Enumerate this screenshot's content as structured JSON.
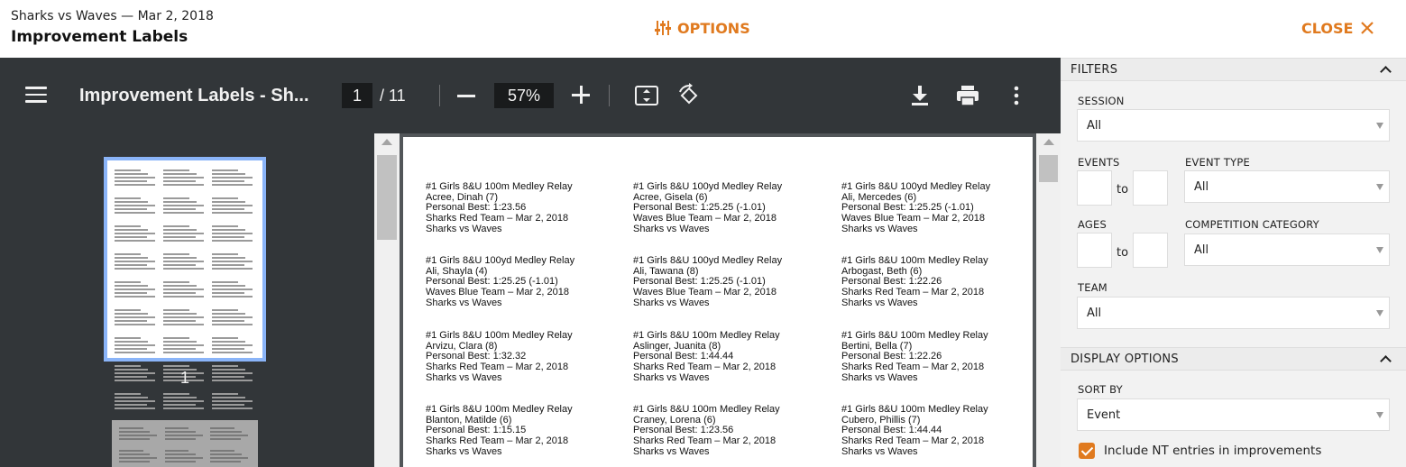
{
  "header": {
    "meet_title": "Sharks vs Waves — Mar 2, 2018",
    "page_title": "Improvement Labels",
    "options_label": "OPTIONS",
    "close_label": "CLOSE",
    "accent_color": "#e07a1f"
  },
  "viewer": {
    "doc_name": "Improvement Labels - Sh...",
    "current_page": "1",
    "total_pages": "/ 11",
    "zoom": "57%",
    "thumbnail_page": "1",
    "icons": [
      "menu-icon",
      "zoom-out-icon",
      "zoom-in-icon",
      "fit-page-icon",
      "rotate-icon",
      "download-icon",
      "print-icon",
      "more-vert-icon"
    ]
  },
  "labels": [
    [
      "#1 Girls 8&U 100m Medley Relay",
      "Acree, Dinah (7)",
      "Personal Best: 1:23.56",
      "Sharks Red Team – Mar 2, 2018",
      "Sharks vs Waves"
    ],
    [
      "#1 Girls 8&U 100yd Medley Relay",
      "Acree, Gisela (6)",
      "Personal Best: 1:25.25   (-1.01)",
      "Waves Blue Team – Mar 2, 2018",
      "Sharks vs Waves"
    ],
    [
      "#1 Girls 8&U 100yd Medley Relay",
      "Ali, Mercedes (6)",
      "Personal Best: 1:25.25   (-1.01)",
      "Waves Blue Team – Mar 2, 2018",
      "Sharks vs Waves"
    ],
    [
      "#1 Girls 8&U 100yd Medley Relay",
      "Ali, Shayla (4)",
      "Personal Best: 1:25.25   (-1.01)",
      "Waves Blue Team – Mar 2, 2018",
      "Sharks vs Waves"
    ],
    [
      "#1 Girls 8&U 100yd Medley Relay",
      "Ali, Tawana (8)",
      "Personal Best: 1:25.25   (-1.01)",
      "Waves Blue Team – Mar 2, 2018",
      "Sharks vs Waves"
    ],
    [
      "#1 Girls 8&U 100m Medley Relay",
      "Arbogast, Beth (6)",
      "Personal Best: 1:22.26",
      "Sharks Red Team – Mar 2, 2018",
      "Sharks vs Waves"
    ],
    [
      "#1 Girls 8&U 100m Medley Relay",
      "Arvizu, Clara (8)",
      "Personal Best: 1:32.32",
      "Sharks Red Team – Mar 2, 2018",
      "Sharks vs Waves"
    ],
    [
      "#1 Girls 8&U 100m Medley Relay",
      "Aslinger, Juanita (8)",
      "Personal Best: 1:44.44",
      "Sharks Red Team – Mar 2, 2018",
      "Sharks vs Waves"
    ],
    [
      "#1 Girls 8&U 100m Medley Relay",
      "Bertini, Bella (7)",
      "Personal Best: 1:22.26",
      "Sharks Red Team – Mar 2, 2018",
      "Sharks vs Waves"
    ],
    [
      "#1 Girls 8&U 100m Medley Relay",
      "Blanton, Matilde (6)",
      "Personal Best: 1:15.15",
      "Sharks Red Team – Mar 2, 2018",
      "Sharks vs Waves"
    ],
    [
      "#1 Girls 8&U 100m Medley Relay",
      "Craney, Lorena (6)",
      "Personal Best: 1:23.56",
      "Sharks Red Team – Mar 2, 2018",
      "Sharks vs Waves"
    ],
    [
      "#1 Girls 8&U 100m Medley Relay",
      "Cubero, Phillis (7)",
      "Personal Best: 1:44.44",
      "Sharks Red Team – Mar 2, 2018",
      "Sharks vs Waves"
    ]
  ],
  "filters": {
    "section_title": "FILTERS",
    "session_label": "SESSION",
    "session_value": "All",
    "events_label": "EVENTS",
    "events_from": "",
    "events_to": "",
    "to_label": "to",
    "event_type_label": "EVENT TYPE",
    "event_type_value": "All",
    "ages_label": "AGES",
    "ages_from": "",
    "ages_to": "",
    "competition_label": "COMPETITION CATEGORY",
    "competition_value": "All",
    "team_label": "TEAM",
    "team_value": "All"
  },
  "display_options": {
    "section_title": "DISPLAY OPTIONS",
    "sort_label": "SORT BY",
    "sort_value": "Event",
    "include_nt_label": "Include NT entries in improvements",
    "include_nt_checked": true
  }
}
